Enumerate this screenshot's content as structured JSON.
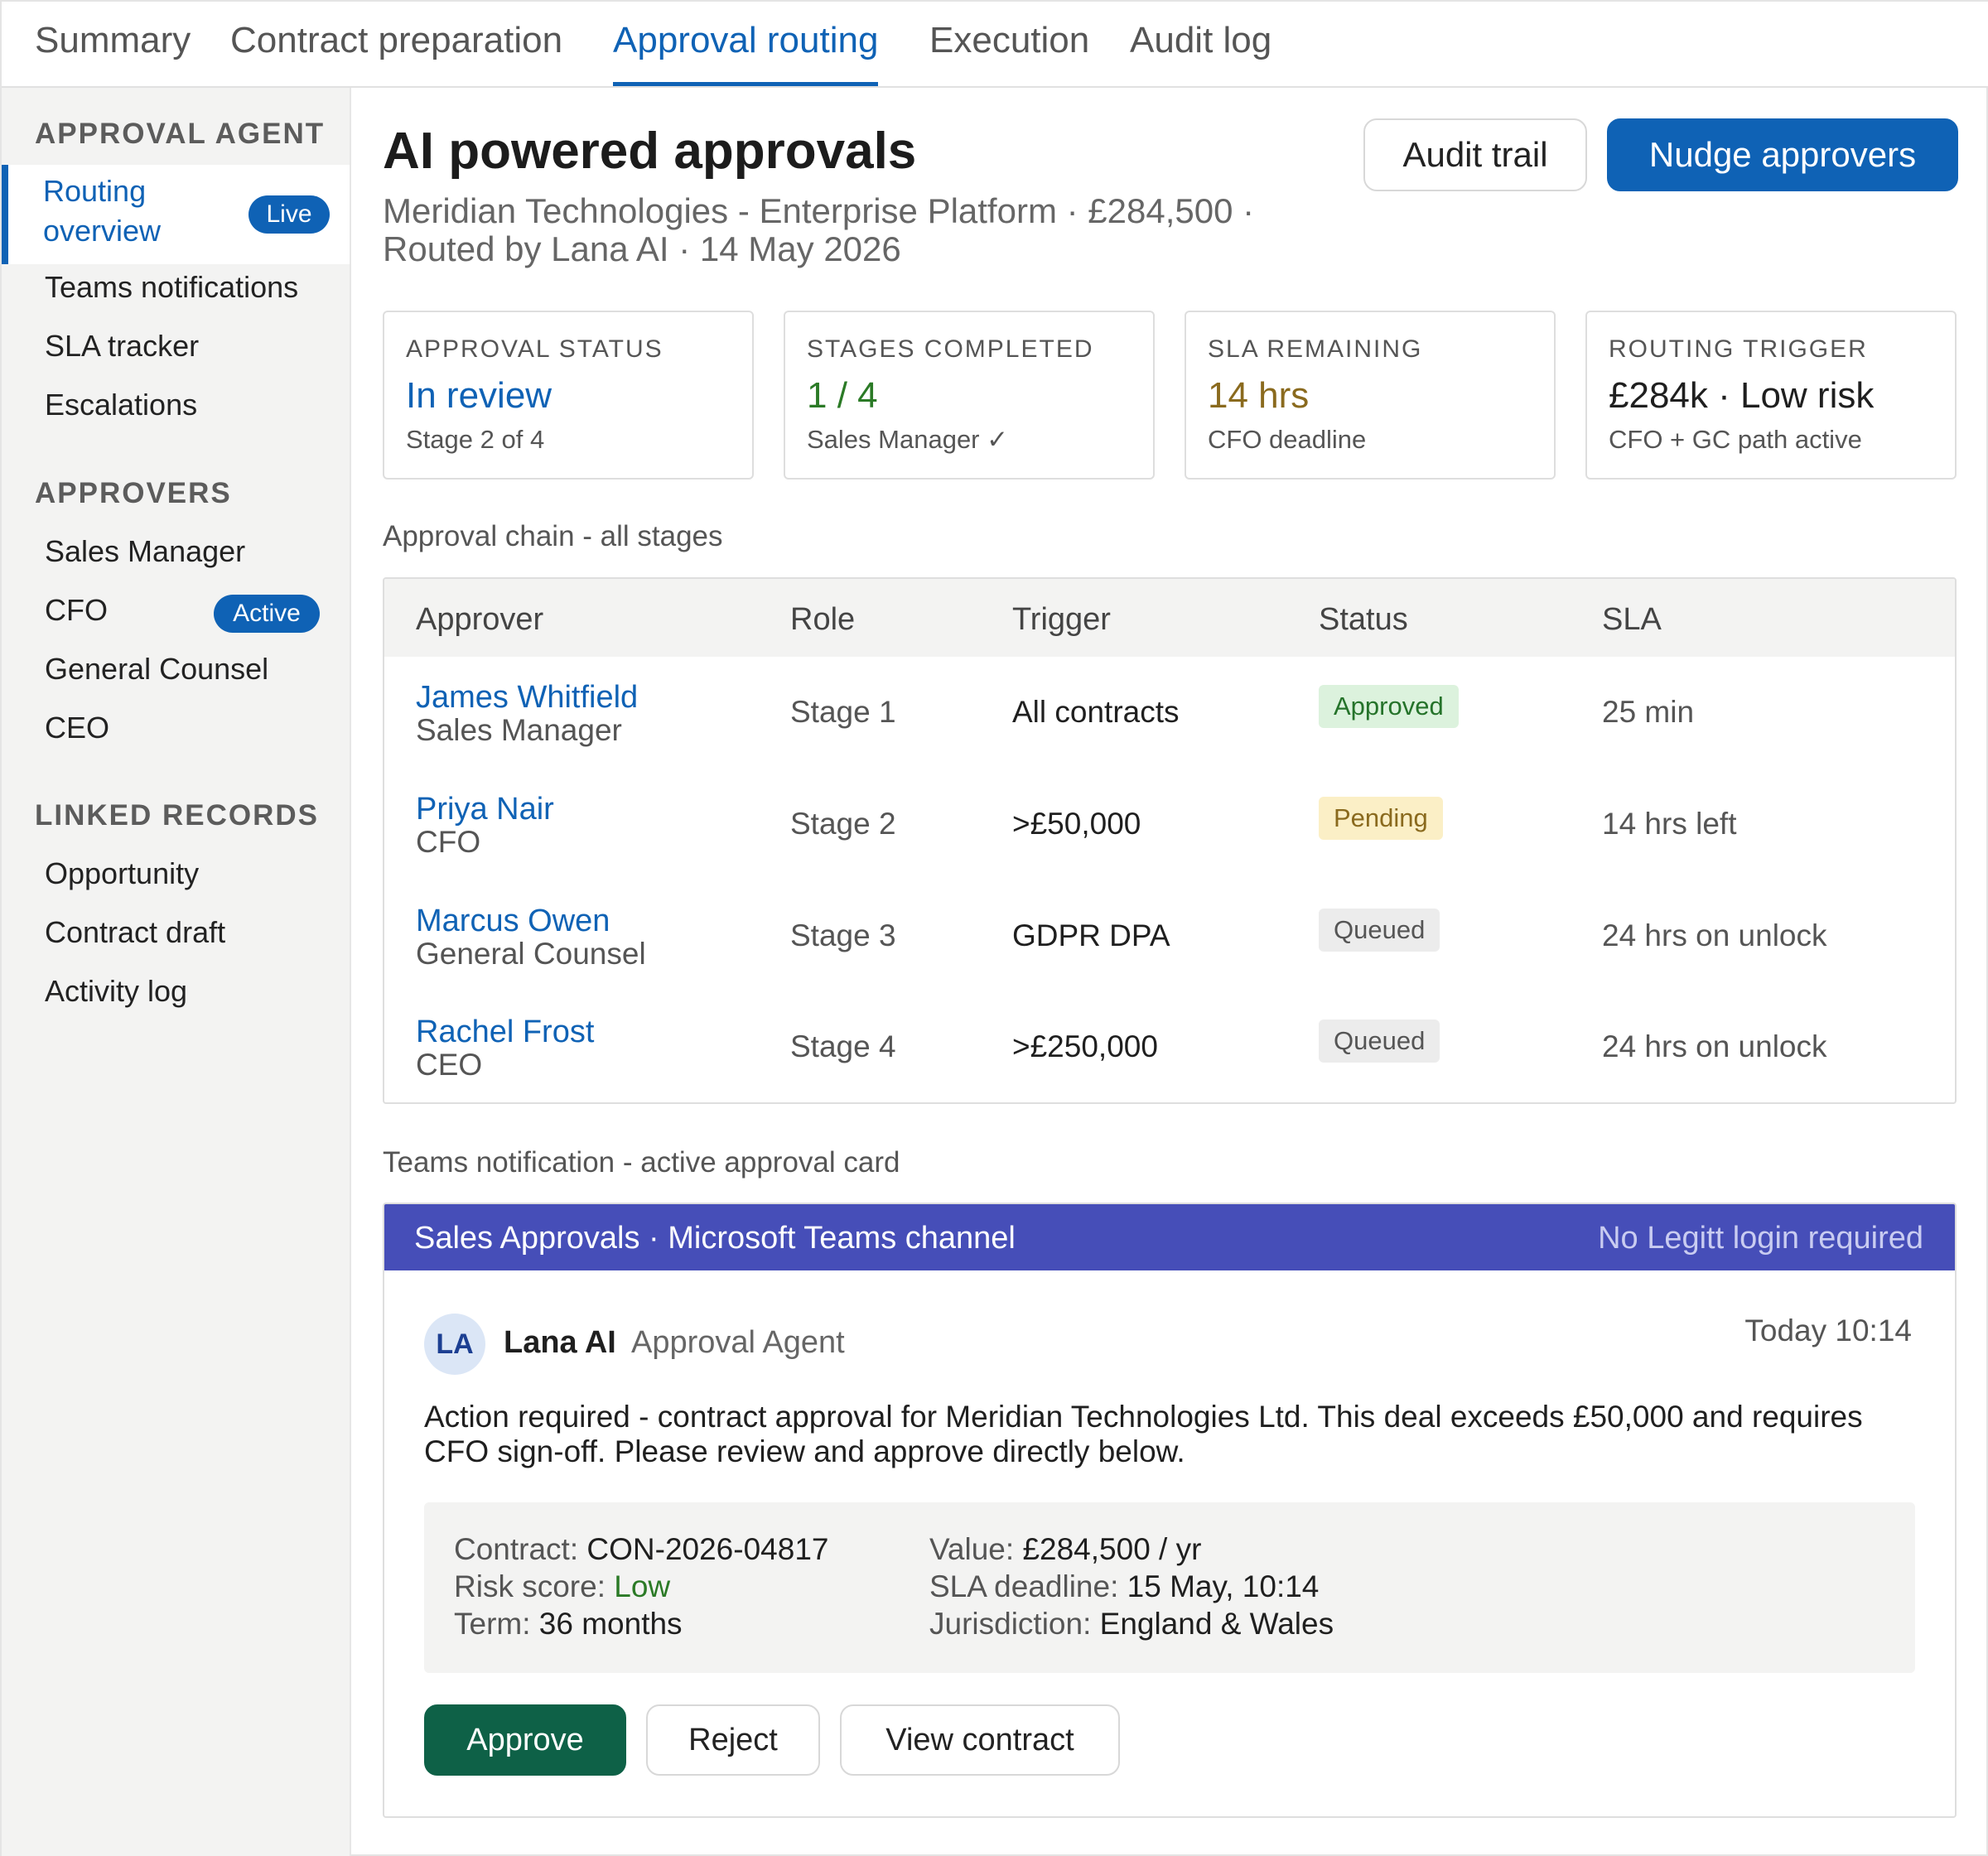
{
  "tabs": [
    {
      "label": "Summary",
      "active": false
    },
    {
      "label": "Contract preparation",
      "active": false
    },
    {
      "label": "Approval routing",
      "active": true
    },
    {
      "label": "Execution",
      "active": false
    },
    {
      "label": "Audit log",
      "active": false
    }
  ],
  "sidebar": {
    "agent_section": "APPROVAL AGENT",
    "agent_items": [
      {
        "label": "Routing overview",
        "badge": "Live",
        "active": true
      },
      {
        "label": "Teams notifications"
      },
      {
        "label": "SLA tracker"
      },
      {
        "label": "Escalations"
      }
    ],
    "approvers_section": "APPROVERS",
    "approver_items": [
      {
        "label": "Sales Manager"
      },
      {
        "label": "CFO",
        "badge": "Active"
      },
      {
        "label": "General Counsel"
      },
      {
        "label": "CEO"
      }
    ],
    "linked_section": "LINKED RECORDS",
    "linked_items": [
      {
        "label": "Opportunity"
      },
      {
        "label": "Contract draft"
      },
      {
        "label": "Activity log"
      }
    ]
  },
  "header": {
    "title": "AI powered approvals",
    "subtitle_line1": "Meridian Technologies - Enterprise Platform · £284,500 ·",
    "subtitle_line2": "Routed by Lana AI · 14 May 2026",
    "audit_trail_label": "Audit trail",
    "nudge_label": "Nudge approvers"
  },
  "stats": [
    {
      "label": "APPROVAL STATUS",
      "value": "In review",
      "sub": "Stage 2 of 4",
      "color": "#0f62b5"
    },
    {
      "label": "STAGES COMPLETED",
      "value": "1 / 4",
      "sub": "Sales Manager ✓",
      "color": "#2b7a26"
    },
    {
      "label": "SLA REMAINING",
      "value": "14 hrs",
      "sub": "CFO deadline",
      "color": "#8a6a1e"
    },
    {
      "label": "ROUTING TRIGGER",
      "value": "£284k · Low risk",
      "sub": "CFO + GC path active",
      "color": "#1f1f1f"
    }
  ],
  "chain": {
    "caption": "Approval chain - all stages",
    "columns": [
      "Approver",
      "Role",
      "Trigger",
      "Status",
      "SLA"
    ],
    "rows": [
      {
        "name": "James Whitfield",
        "title": "Sales Manager",
        "role": "Stage 1",
        "trigger": "All contracts",
        "status": "Approved",
        "sla": "25 min"
      },
      {
        "name": "Priya Nair",
        "title": "CFO",
        "role": "Stage 2",
        "trigger": ">£50,000",
        "status": "Pending",
        "sla": "14 hrs left"
      },
      {
        "name": "Marcus Owen",
        "title": "General Counsel",
        "role": "Stage 3",
        "trigger": "GDPR DPA",
        "status": "Queued",
        "sla": "24 hrs on unlock"
      },
      {
        "name": "Rachel Frost",
        "title": "CEO",
        "role": "Stage 4",
        "trigger": ">£250,000",
        "status": "Queued",
        "sla": "24 hrs on unlock"
      }
    ],
    "status_colors": {
      "Approved": {
        "bg": "#dcf2dd",
        "fg": "#25732a"
      },
      "Pending": {
        "bg": "#fbefc6",
        "fg": "#8a6a1e"
      },
      "Queued": {
        "bg": "#ececec",
        "fg": "#555555"
      }
    }
  },
  "teams": {
    "caption": "Teams notification - active approval card",
    "channel": "Sales Approvals · Microsoft Teams channel",
    "no_login": "No Legitt login required",
    "avatar_initials": "LA",
    "sender": "Lana AI",
    "sender_role": "Approval Agent",
    "time": "Today 10:14",
    "message": "Action required - contract approval for Meridian Technologies Ltd. This deal exceeds £50,000 and requires CFO sign-off. Please review and approve directly below.",
    "details": {
      "contract_label": "Contract:",
      "contract": "CON-2026-04817",
      "risk_label": "Risk score:",
      "risk": "Low",
      "term_label": "Term:",
      "term": "36 months",
      "value_label": "Value:",
      "value": "£284,500 / yr",
      "sla_label": "SLA deadline:",
      "sla": "15 May, 10:14",
      "jurisdiction_label": "Jurisdiction:",
      "jurisdiction": "England & Wales"
    },
    "approve_label": "Approve",
    "reject_label": "Reject",
    "view_label": "View contract"
  },
  "colors": {
    "accent": "#0f62b5",
    "teams": "#464eb8",
    "approve": "#0e6147"
  }
}
